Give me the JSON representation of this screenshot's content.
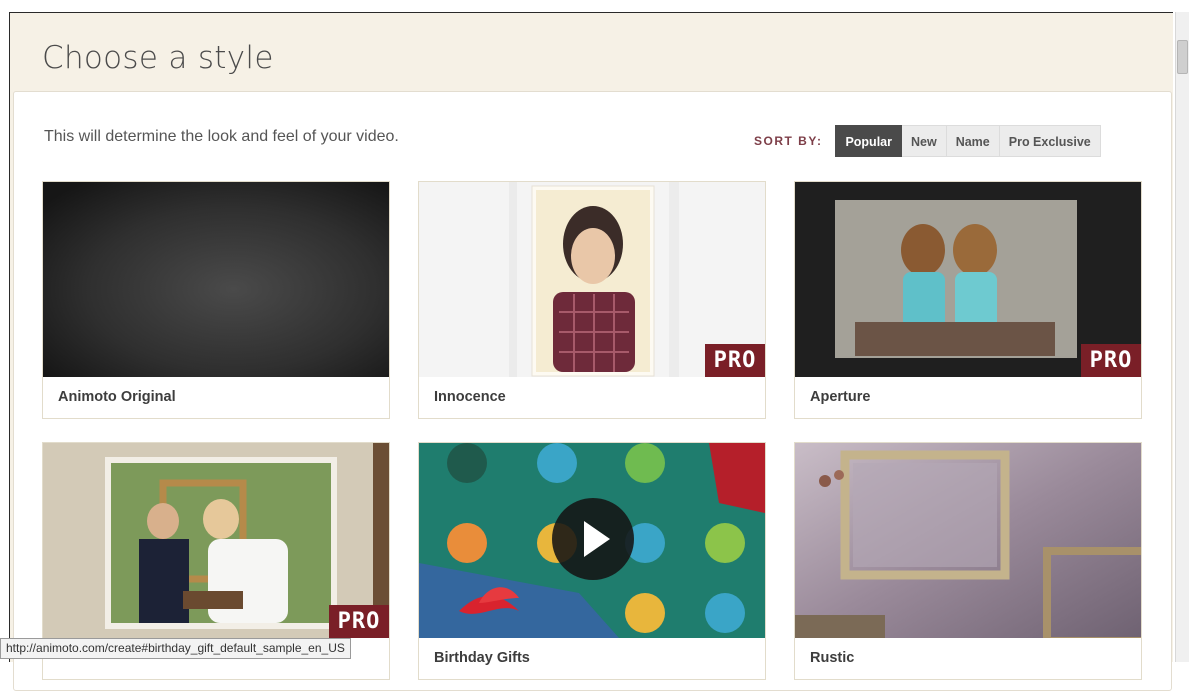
{
  "page": {
    "title": "Choose a style",
    "subtitle": "This will determine the look and feel of your video."
  },
  "sort": {
    "label": "SORT BY:",
    "options": [
      "Popular",
      "New",
      "Name",
      "Pro Exclusive"
    ],
    "selected": "Popular"
  },
  "styles": [
    {
      "name": "Animoto Original",
      "pro": false
    },
    {
      "name": "Innocence",
      "pro": true,
      "badge": "PRO"
    },
    {
      "name": "Aperture",
      "pro": true,
      "badge": "PRO"
    },
    {
      "name": "",
      "pro": true,
      "badge": "PRO"
    },
    {
      "name": "Birthday Gifts",
      "pro": false,
      "play_button": true
    },
    {
      "name": "Rustic",
      "pro": false
    }
  ],
  "status_bar": {
    "url": "http://animoto.com/create#birthday_gift_default_sample_en_US"
  },
  "colors": {
    "pro_badge": "#7a1f27",
    "sort_label": "#7d3e48",
    "active_sort": "#4a4a4a",
    "header_bg": "#f6f1e6"
  }
}
